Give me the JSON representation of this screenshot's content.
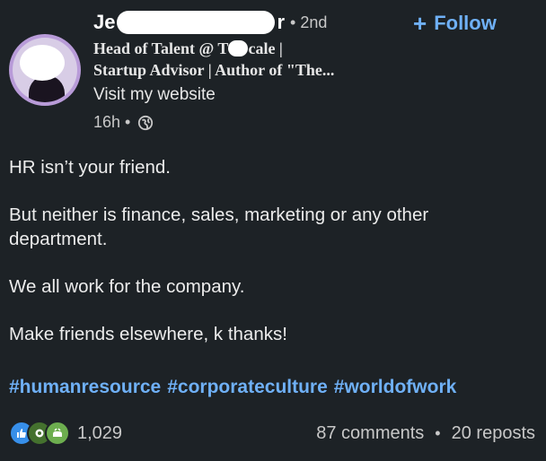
{
  "post": {
    "author": {
      "name_start": "Je",
      "name_end": "r",
      "degree": "• 2nd",
      "headline_line1_a": "Head of Talent @ T",
      "headline_line1_b": "cale |",
      "headline_line2": "Startup Advisor | Author of \"The...",
      "website_label": "Visit my website"
    },
    "follow_label": "Follow",
    "time": "16h •",
    "paragraphs": [
      "HR isn’t your friend.",
      "But neither is finance, sales, marketing or any other department.",
      "We all work for the company.",
      "Make friends elsewhere, k thanks!"
    ],
    "hashtags": [
      "#humanresource",
      "#corporateculture",
      "#worldofwork"
    ],
    "reaction_count": "1,029",
    "comments": "87 comments",
    "separator": "•",
    "reposts": "20 reposts"
  },
  "colors": {
    "background": "#1d2226",
    "link": "#6fb0f6",
    "like": "#378fe9",
    "celebrate": "#44712e",
    "support": "#6dae4f"
  },
  "icons": [
    "globe-icon",
    "like-reaction-icon",
    "celebrate-reaction-icon",
    "support-reaction-icon",
    "plus-icon"
  ]
}
